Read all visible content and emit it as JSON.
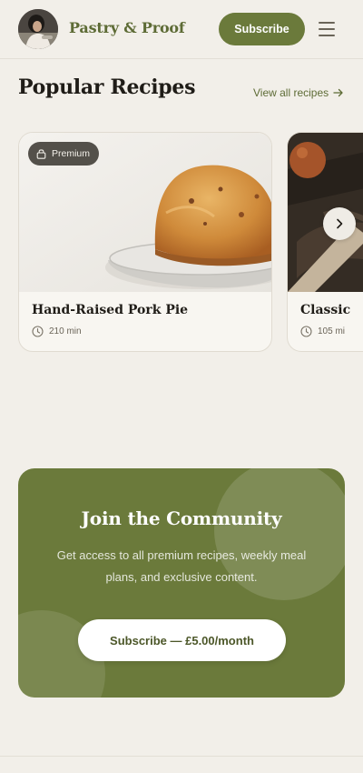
{
  "header": {
    "brand": "Pastry & Proof",
    "subscribe_label": "Subscribe",
    "avatar_icon": "chef-portrait",
    "menu_icon": "hamburger-menu-icon"
  },
  "section": {
    "title": "Popular Recipes",
    "view_all_label": "View all recipes",
    "view_all_icon": "arrow-right-icon"
  },
  "cards": [
    {
      "badge": "Premium",
      "badge_icon": "lock-icon",
      "title": "Hand-Raised Pork Pie",
      "time": "210 min",
      "time_icon": "clock-icon"
    },
    {
      "title": "Classic",
      "time": "105 mi",
      "time_icon": "clock-icon"
    }
  ],
  "carousel": {
    "next_icon": "chevron-right-icon"
  },
  "community": {
    "title": "Join the Community",
    "description": "Get access to all premium recipes, weekly meal plans, and exclusive content.",
    "button_label": "Subscribe — £5.00/month"
  },
  "colors": {
    "background": "#f2efe9",
    "accent": "#6b7a3b",
    "brand_text": "#5d6b35"
  }
}
